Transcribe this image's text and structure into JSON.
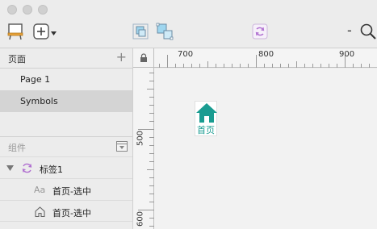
{
  "toolbar": {
    "icons": [
      "artboard-icon",
      "add-icon",
      "chevron-down-icon",
      "group-icon",
      "ungroup-icon",
      "symbol-icon",
      "zoom-out-icon",
      "zoom-icon"
    ],
    "zoom_minus": "-"
  },
  "pages_panel": {
    "title": "页面",
    "add": "+",
    "items": [
      {
        "label": "Page 1",
        "selected": false
      },
      {
        "label": "Symbols",
        "selected": true
      }
    ]
  },
  "components_panel": {
    "title": "组件",
    "layers": [
      {
        "label": "标签1",
        "icon": "symbol-icon",
        "expanded": true
      },
      {
        "label": "首页-选中",
        "icon": "text-icon",
        "icon_text": "Aa"
      },
      {
        "label": "首页-选中",
        "icon": "home-outline-icon"
      }
    ]
  },
  "rulers": {
    "horizontal_labels": [
      "700",
      "800",
      "900"
    ],
    "vertical_labels": [
      "500",
      "600"
    ]
  },
  "canvas": {
    "symbol_label": "首页",
    "accent": "#1a9c91"
  },
  "colors": {
    "accent": "#1a9c91",
    "symbol_purple": "#b06fd0"
  }
}
